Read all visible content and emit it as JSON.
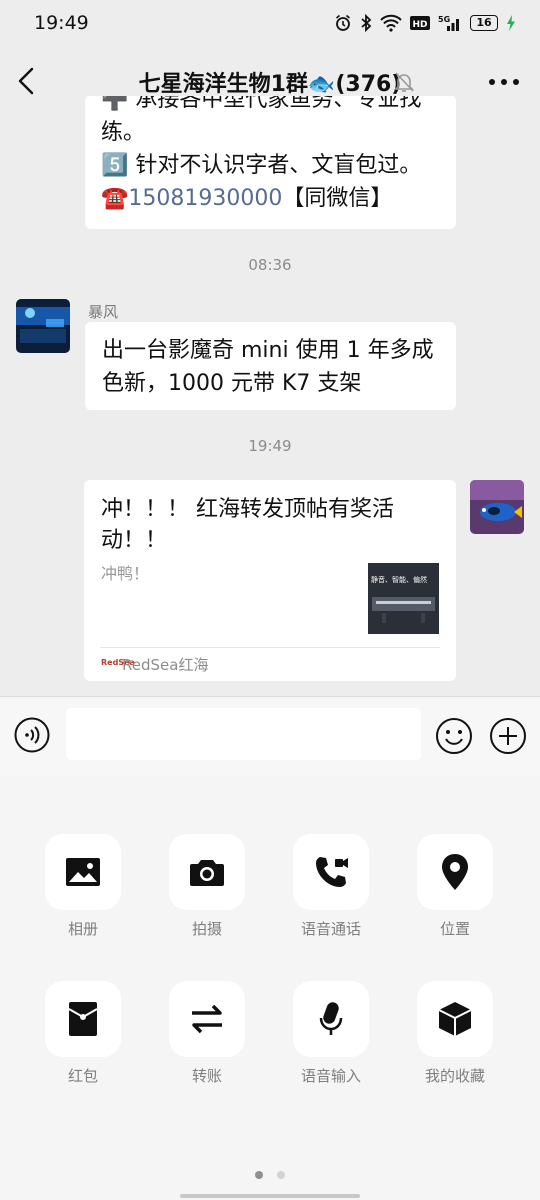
{
  "status_bar": {
    "time": "19:49",
    "battery": "16"
  },
  "header": {
    "title": "七星海洋生物1群🐟(376)"
  },
  "messages": {
    "first": {
      "line0": "➕ 承接各中型代家鱼务、专业找",
      "line1": "练。",
      "line2": "5️⃣ 针对不认识字者、文盲包过。",
      "phone_prefix": "☎️",
      "phone": "15081930000",
      "phone_suffix": "【同微信】"
    },
    "time1": "08:36",
    "sender": "暴风",
    "second": "出一台影魔奇 mini 使用 1 年多成色新，1000 元带 K7 支架",
    "time2": "19:49",
    "card": {
      "title": "冲！！！ 红海转发顶帖有奖活动！！",
      "desc": "冲鸭！",
      "thumb_text": "静音、智能、偏然",
      "source_logo": "RedSea",
      "source": "RedSea红海"
    }
  },
  "input": {
    "value": "",
    "placeholder": ""
  },
  "panel": {
    "items": [
      {
        "label": "相册",
        "icon": "photo-album-icon"
      },
      {
        "label": "拍摄",
        "icon": "camera-icon"
      },
      {
        "label": "语音通话",
        "icon": "voice-call-icon"
      },
      {
        "label": "位置",
        "icon": "location-icon"
      },
      {
        "label": "红包",
        "icon": "red-packet-icon"
      },
      {
        "label": "转账",
        "icon": "transfer-icon"
      },
      {
        "label": "语音输入",
        "icon": "voice-input-icon"
      },
      {
        "label": "我的收藏",
        "icon": "favorites-icon"
      }
    ],
    "page_count": 2,
    "active_page": 1
  },
  "colors": {
    "link": "#576b95",
    "background": "#ededed",
    "bubble": "#ffffff"
  }
}
